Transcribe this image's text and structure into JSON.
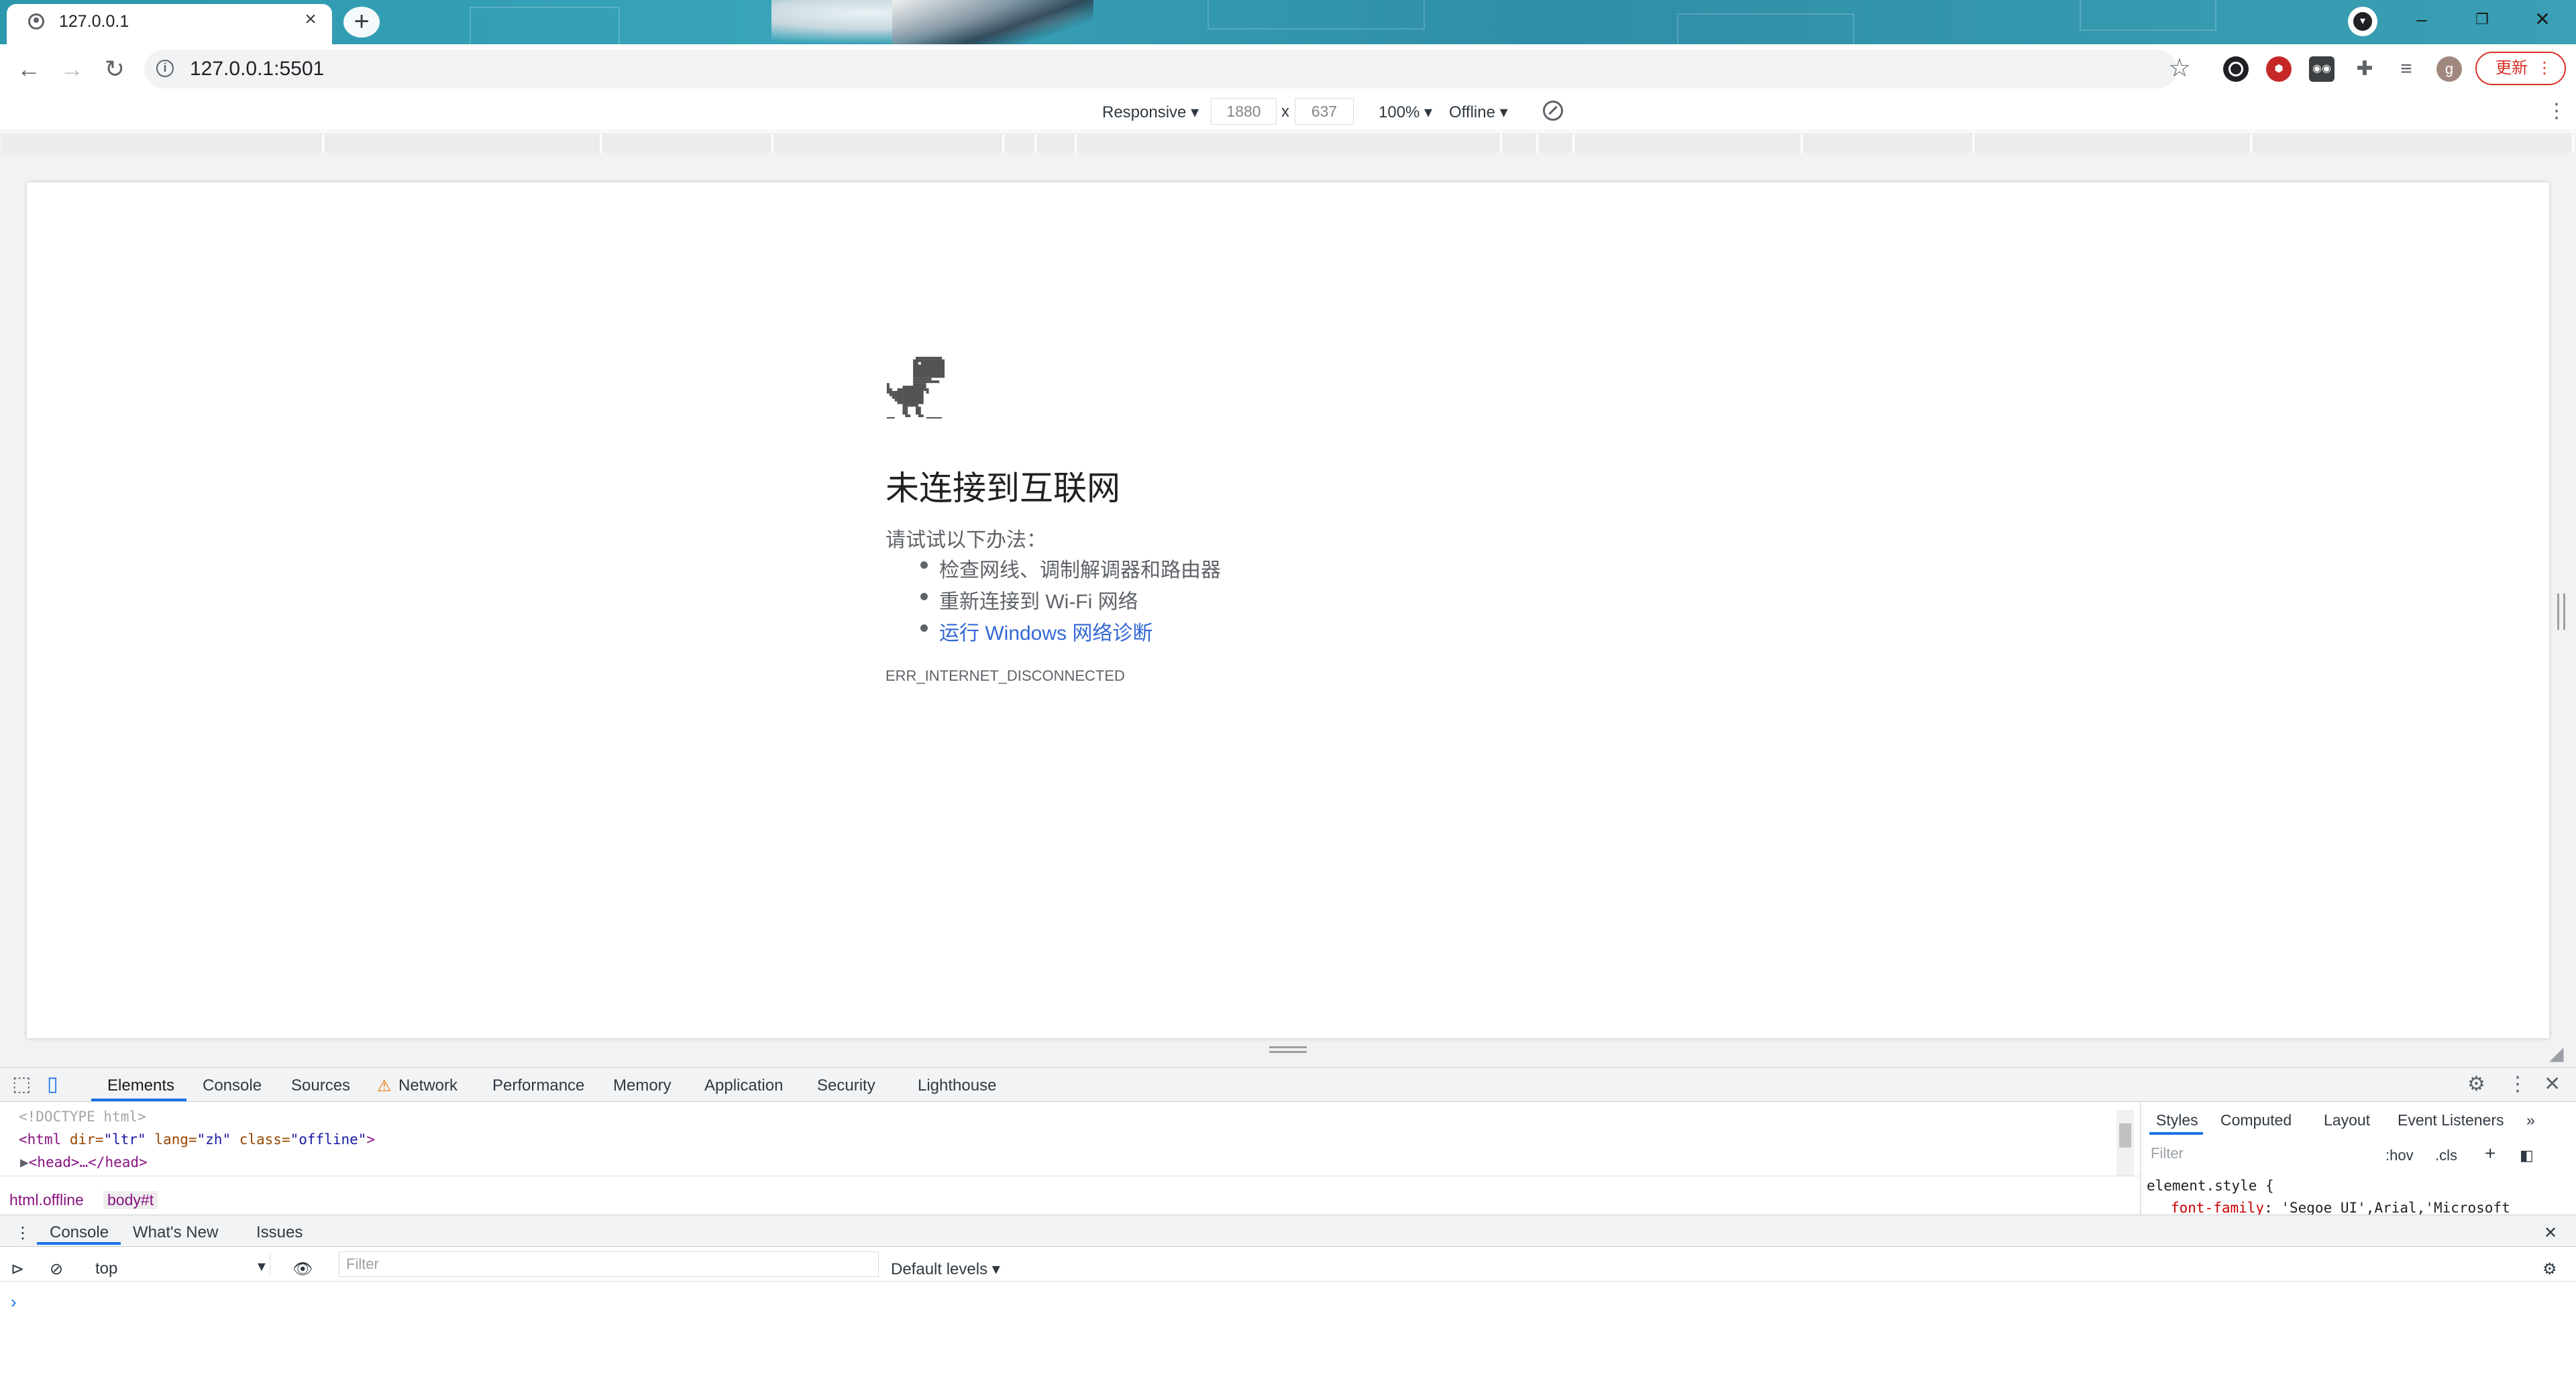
{
  "browser": {
    "tab_title": "127.0.0.1",
    "tab_close": "×",
    "new_tab": "+",
    "url": "127.0.0.1:5501",
    "update_label": "更新",
    "profile_initial": "g",
    "window_min": "–",
    "window_restore": "❐",
    "window_close": "✕"
  },
  "device_toolbar": {
    "device": "Responsive ▾",
    "width": "1880",
    "times": "x",
    "height": "637",
    "zoom": "100% ▾",
    "throttling": "Offline ▾",
    "menu": "⋮"
  },
  "page": {
    "title": "未连接到互联网",
    "subtitle": "请试试以下办法：",
    "suggestions": [
      "检查网线、调制解调器和路由器",
      "重新连接到 Wi-Fi 网络",
      "运行 Windows 网络诊断"
    ],
    "error_code": "ERR_INTERNET_DISCONNECTED"
  },
  "devtools": {
    "tabs": [
      "Elements",
      "Console",
      "Sources",
      "Network",
      "Performance",
      "Memory",
      "Application",
      "Security",
      "Lighthouse"
    ],
    "code_lines": {
      "doctype": "<!DOCTYPE html>",
      "html_open_tag": "<html",
      "html_attr1": " dir=",
      "html_val1": "\"ltr\"",
      "html_attr2": " lang=",
      "html_val2": "\"zh\"",
      "html_attr3": " class=",
      "html_val3": "\"offline\"",
      "html_close": ">",
      "head": "<head>…</head>"
    },
    "breadcrumbs": [
      "html.offline",
      "body#t"
    ],
    "styles_tabs": [
      "Styles",
      "Computed",
      "Layout",
      "Event Listeners",
      "»"
    ],
    "styles_filter_placeholder": "Filter",
    "hov": ":hov",
    "cls": ".cls",
    "rule_selector": "element.style {",
    "rule_prop": "font-family",
    "rule_value": ": 'Segoe UI',Arial,'Microsoft"
  },
  "drawer": {
    "tabs": [
      "Console",
      "What's New",
      "Issues"
    ],
    "context": "top",
    "filter_placeholder": "Filter",
    "levels": "Default levels ▾",
    "prompt": "›"
  }
}
